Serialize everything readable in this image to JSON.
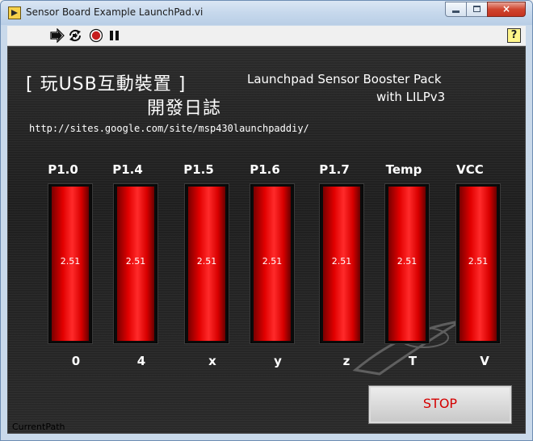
{
  "window": {
    "title": "Sensor Board Example LaunchPad.vi"
  },
  "window_buttons": {
    "close_glyph": "×"
  },
  "toolbar": {
    "icons": [
      "run-arrow-icon",
      "run-continuously-icon",
      "abort-icon",
      "pause-icon"
    ],
    "help_label": "?"
  },
  "panel": {
    "heading_cn_line1": "[  玩USB互動裝置  ]",
    "heading_cn_line2": "開發日誌",
    "heading_en_line1": "Launchpad Sensor Booster Pack",
    "heading_en_line2": "with LILPv3",
    "url": "http://sites.google.com/site/msp430launchpaddiy/",
    "channels": [
      {
        "label": "P1.0",
        "value": "2.51",
        "axis": "0"
      },
      {
        "label": "P1.4",
        "value": "2.51",
        "axis": "4"
      },
      {
        "label": "P1.5",
        "value": "2.51",
        "axis": "x"
      },
      {
        "label": "P1.6",
        "value": "2.51",
        "axis": "y"
      },
      {
        "label": "P1.7",
        "value": "2.51",
        "axis": "z"
      },
      {
        "label": "Temp",
        "value": "2.51",
        "axis": "T"
      },
      {
        "label": "VCC",
        "value": "2.51",
        "axis": "V"
      }
    ],
    "bar_fill_fraction": 1.0,
    "stop_label": "STOP",
    "current_path_label": "CurrentPath"
  },
  "colors": {
    "panel_bg": "#262626",
    "bar_red": "#e10000",
    "stop_text": "#d40000",
    "help_bg": "#fff58a"
  }
}
